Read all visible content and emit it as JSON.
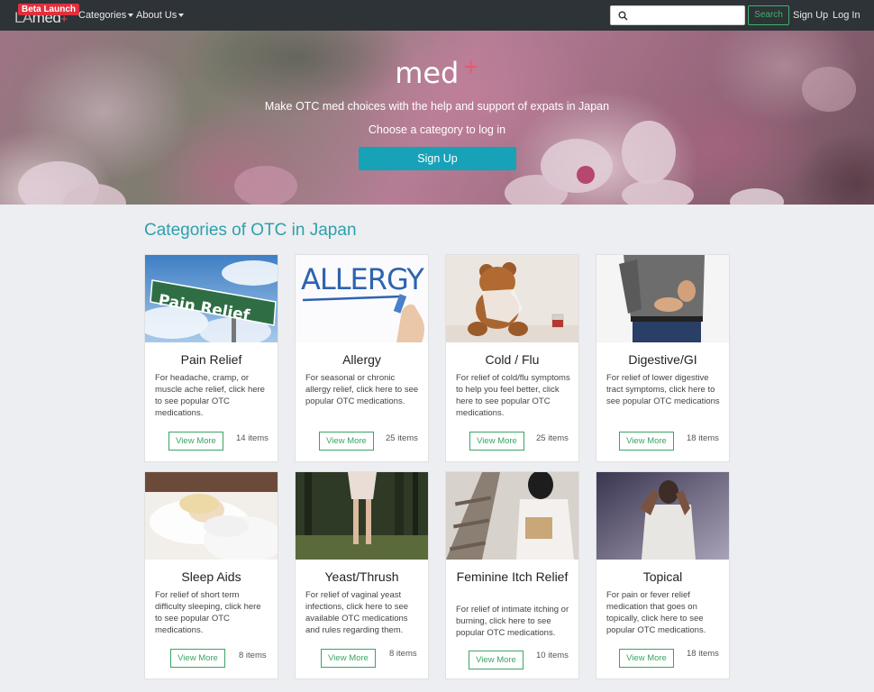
{
  "navbar": {
    "brand_la": "LA",
    "brand_med": "med",
    "brand_plus": "+",
    "beta_badge": "Beta Launch",
    "categories_label": "Categories",
    "about_label": "About Us",
    "search_placeholder": "",
    "search_button": "Search",
    "signup_link": "Sign Up",
    "login_link": "Log In"
  },
  "hero": {
    "title": "med",
    "title_plus": "+",
    "subtitle": "Make OTC med choices with the help and support of expats in Japan",
    "prompt": "Choose a category to log in",
    "signup_button": "Sign Up"
  },
  "section": {
    "title": "Categories of OTC in Japan"
  },
  "categories": [
    {
      "title": "Pain Relief",
      "desc": "For headache, cramp, or muscle ache relief, click here to see popular OTC medications.",
      "button": "View More",
      "count": "14 items",
      "image": "pain-relief-road-sign"
    },
    {
      "title": "Allergy",
      "desc": "For seasonal or chronic allergy relief, click here to see popular OTC medications.",
      "button": "View More",
      "count": "25 items",
      "image": "allergy-handwriting"
    },
    {
      "title": "Cold / Flu",
      "desc": "For relief of cold/flu symptoms to help you feel better, click here to see popular OTC medications.",
      "button": "View More",
      "count": "25 items",
      "image": "teddy-bear-tissues"
    },
    {
      "title": "Digestive/GI",
      "desc": "For relief of lower digestive tract symptoms, click here to see popular OTC medications",
      "button": "View More",
      "count": "18 items",
      "image": "stomach-ache-person"
    },
    {
      "title": "Sleep Aids",
      "desc": "For relief of short term difficulty sleeping, click here to see popular OTC medications.",
      "button": "View More",
      "count": "8 items",
      "image": "woman-sleeping"
    },
    {
      "title": "Yeast/Thrush",
      "desc": "For relief of vaginal yeast infections, click here to see available OTC medications and rules regarding them.",
      "button": "View More",
      "count": "8 items",
      "image": "woman-in-forest"
    },
    {
      "title": "Feminine Itch Relief",
      "desc": "For relief of intimate itching or burning, click here to see popular OTC medications.",
      "button": "View More",
      "count": "10 items",
      "image": "woman-reading-rails"
    },
    {
      "title": "Topical",
      "desc": "For pain or fever relief medication that goes on topically, click here to see popular OTC medications.",
      "button": "View More",
      "count": "18 items",
      "image": "man-neck-pain"
    }
  ]
}
